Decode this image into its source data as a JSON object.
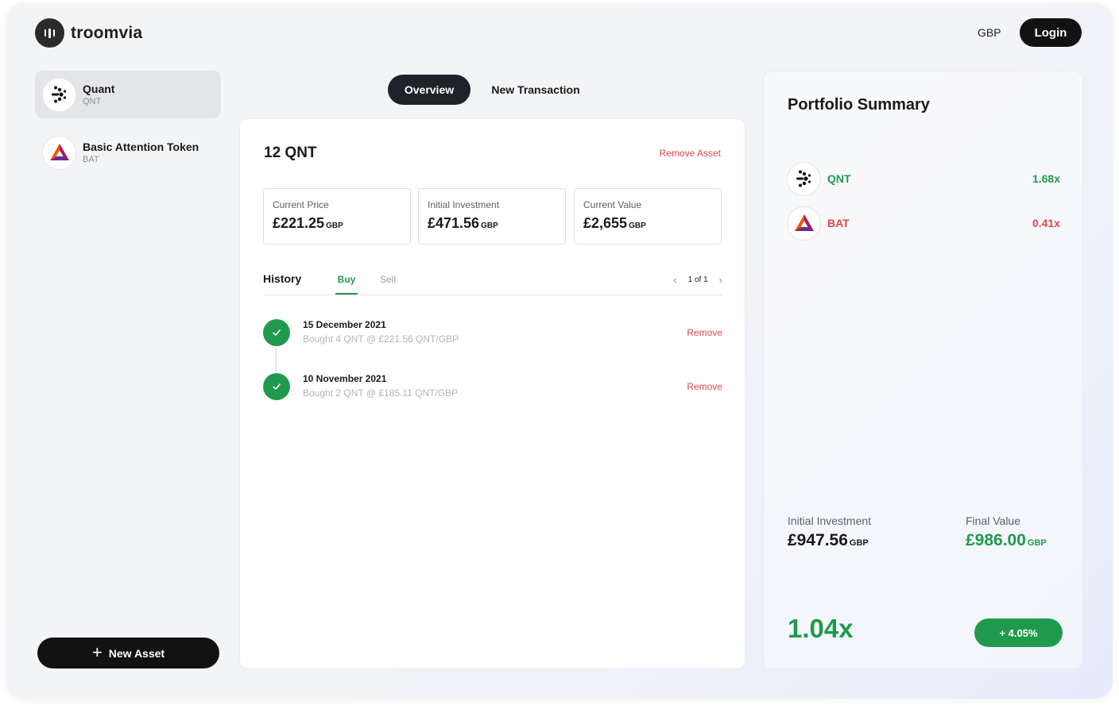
{
  "brand": {
    "name": "troomvia",
    "logo_icon": "bar-chart-icon"
  },
  "header": {
    "currency": "GBP",
    "login_label": "Login"
  },
  "sidebar": {
    "assets": [
      {
        "name": "Quant",
        "symbol": "QNT",
        "icon": "quant-logo-icon",
        "active": true
      },
      {
        "name": "Basic Attention Token",
        "symbol": "BAT",
        "icon": "bat-logo-icon",
        "active": false
      }
    ],
    "new_asset_label": "New Asset"
  },
  "tabs": {
    "overview": "Overview",
    "new_transaction": "New Transaction"
  },
  "main": {
    "holding": "12 QNT",
    "remove_asset_label": "Remove Asset",
    "stats": [
      {
        "label": "Current Price",
        "value": "£221.25",
        "currency": "GBP"
      },
      {
        "label": "Initial Investment",
        "value": "£471.56",
        "currency": "GBP"
      },
      {
        "label": "Current Value",
        "value": "£2,655",
        "currency": "GBP"
      }
    ],
    "history": {
      "title": "History",
      "tab_buy": "Buy",
      "tab_sell": "Sell",
      "page": "1 of 1",
      "transactions": [
        {
          "date": "15 December 2021",
          "description": "Bought 4 QNT @ £221.56 QNT/GBP",
          "remove_label": "Remove"
        },
        {
          "date": "10 November 2021",
          "description": "Bought 2 QNT @ £185.11 QNT/GBP",
          "remove_label": "Remove"
        }
      ]
    }
  },
  "summary": {
    "title": "Portfolio Summary",
    "assets": [
      {
        "symbol": "QNT",
        "multiplier": "1.68x",
        "trend": "up"
      },
      {
        "symbol": "BAT",
        "multiplier": "0.41x",
        "trend": "down"
      }
    ],
    "initial_investment": {
      "label": "Initial Investment",
      "value": "£947.56",
      "currency": "GBP"
    },
    "final_value": {
      "label": "Final Value",
      "value": "£986.00",
      "currency": "GBP"
    },
    "total_multiplier": "1.04x",
    "change_pct": "+ 4.05%"
  },
  "colors": {
    "positive": "#1f9a4c",
    "negative": "#e0474c",
    "primary_dark": "#121212"
  }
}
